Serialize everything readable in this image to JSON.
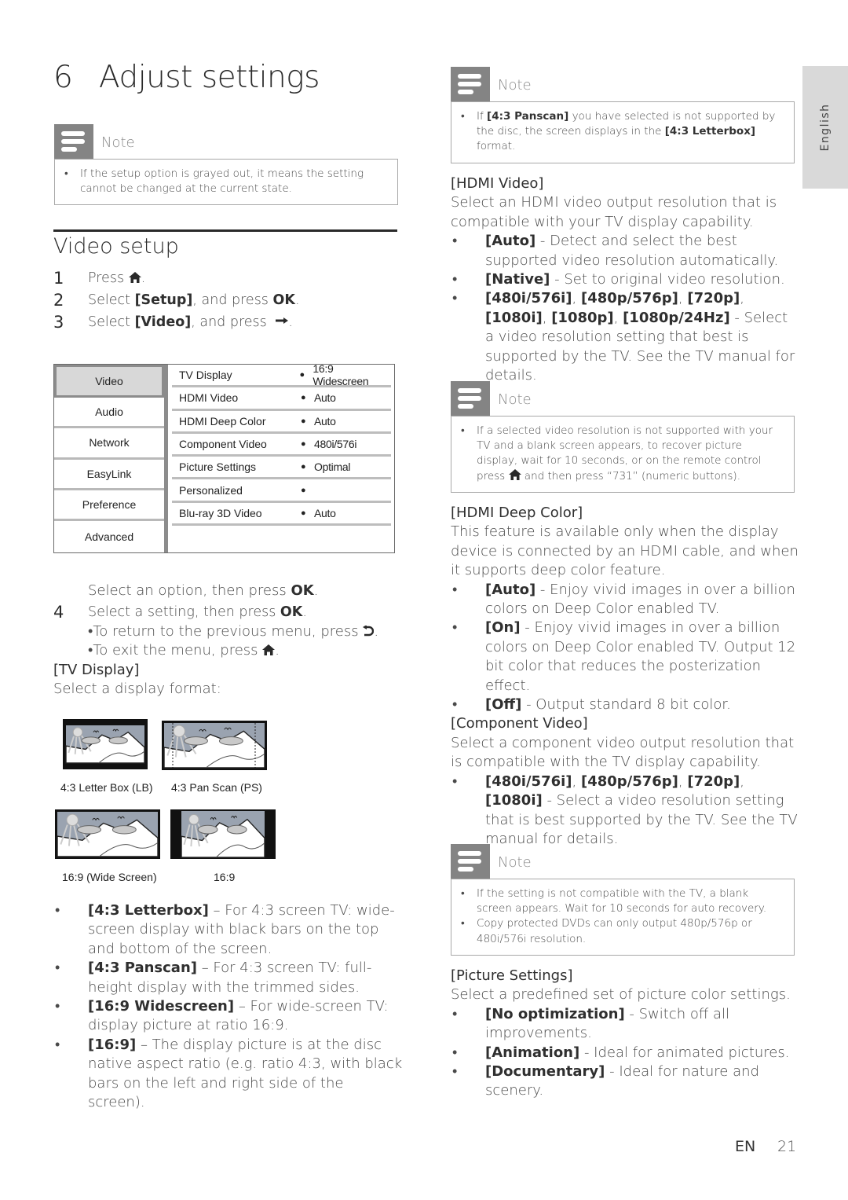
{
  "chapter": {
    "number": "6",
    "title": "Adjust settings"
  },
  "language_tab": "English",
  "notes": [
    {
      "label": "Note",
      "items": [
        {
          "parts": [
            {
              "t": "If the setup option is grayed out, it means the setting cannot be changed at the current state."
            }
          ]
        }
      ]
    },
    {
      "label": "Note",
      "items": [
        {
          "parts": [
            {
              "t": "If "
            },
            {
              "b": "[4:3 Panscan]"
            },
            {
              "t": " you have selected is not supported by the disc, the screen displays in the "
            },
            {
              "b": "[4:3 Letterbox]"
            },
            {
              "t": " format."
            }
          ]
        }
      ]
    },
    {
      "label": "Note",
      "items": [
        {
          "parts": [
            {
              "t": "If a selected video resolution is not supported with your TV and a blank screen appears, to recover picture display, wait for 10 seconds, or on the remote control press "
            },
            {
              "icon": "home"
            },
            {
              "t": " and then press “731” (numeric buttons)."
            }
          ]
        }
      ]
    },
    {
      "label": "Note",
      "items": [
        {
          "parts": [
            {
              "t": "If the setting is not compatible with the TV, a blank screen appears. Wait for 10 seconds for auto recovery."
            }
          ]
        },
        {
          "parts": [
            {
              "t": "Copy protected DVDs can only output 480p/576p or 480i/576i resolution."
            }
          ]
        }
      ]
    }
  ],
  "section": {
    "title": "Video setup",
    "steps": [
      {
        "n": "1",
        "parts": [
          {
            "t": "Press "
          },
          {
            "icon": "home"
          },
          {
            "t": "."
          }
        ]
      },
      {
        "n": "2",
        "parts": [
          {
            "t": "Select "
          },
          {
            "b": "[Setup]"
          },
          {
            "t": ", and press "
          },
          {
            "b": "OK"
          },
          {
            "t": "."
          }
        ]
      },
      {
        "n": "3",
        "parts": [
          {
            "t": "Select "
          },
          {
            "b": "[Video]"
          },
          {
            "t": ", and press "
          },
          {
            "icon": "right"
          },
          {
            "t": "."
          }
        ]
      }
    ],
    "after_menu": {
      "parts": [
        {
          "t": "Select an option, then press "
        },
        {
          "b": "OK"
        },
        {
          "t": "."
        }
      ]
    },
    "step4": {
      "n": "4",
      "parts": [
        {
          "t": "Select a setting, then press "
        },
        {
          "b": "OK"
        },
        {
          "t": "."
        }
      ]
    },
    "step4_sub": [
      {
        "parts": [
          {
            "t": "To return to the previous menu, press "
          },
          {
            "icon": "back"
          },
          {
            "t": "."
          }
        ]
      },
      {
        "parts": [
          {
            "t": "To exit the menu, press "
          },
          {
            "icon": "home"
          },
          {
            "t": "."
          }
        ]
      }
    ]
  },
  "menu": {
    "categories": [
      "Video",
      "Audio",
      "Network",
      "EasyLink",
      "Preference",
      "Advanced"
    ],
    "selected_category": "Video",
    "options": [
      {
        "name": "TV Display",
        "value": "16:9 Widescreen"
      },
      {
        "name": "HDMI Video",
        "value": "Auto"
      },
      {
        "name": "HDMI Deep Color",
        "value": "Auto"
      },
      {
        "name": "Component Video",
        "value": "480i/576i"
      },
      {
        "name": "Picture Settings",
        "value": "Optimal"
      },
      {
        "name": "Personalized",
        "value": ""
      },
      {
        "name": "Blu-ray 3D Video",
        "value": "Auto"
      }
    ]
  },
  "tv_display": {
    "heading": "[TV Display]",
    "intro": "Select a display format:",
    "formats": [
      {
        "caption": "4:3 Letter Box (LB)",
        "kind": "letterbox"
      },
      {
        "caption": "4:3 Pan Scan (PS)",
        "kind": "panscan"
      },
      {
        "caption": "16:9 (Wide Screen)",
        "kind": "wide"
      },
      {
        "caption": "16:9",
        "kind": "pillar"
      }
    ],
    "bullets": [
      {
        "parts": [
          {
            "b": "[4:3 Letterbox]"
          },
          {
            "t": " – For 4:3 screen TV: wide-screen display with black bars on the top and bottom of the screen."
          }
        ]
      },
      {
        "parts": [
          {
            "b": "[4:3 Panscan]"
          },
          {
            "t": " – For 4:3 screen TV: full-height display with the trimmed sides."
          }
        ]
      },
      {
        "parts": [
          {
            "b": "[16:9 Widescreen]"
          },
          {
            "t": " – For wide-screen TV: display picture at ratio 16:9."
          }
        ]
      },
      {
        "parts": [
          {
            "b": "[16:9]"
          },
          {
            "t": " – The display picture is at the disc native aspect ratio (e.g. ratio 4:3, with black bars on the left and right side of the screen)."
          }
        ]
      }
    ]
  },
  "hdmi_video": {
    "heading": "[HDMI Video]",
    "intro": "Select an HDMI video output resolution that is compatible with your TV display capability.",
    "bullets": [
      {
        "parts": [
          {
            "b": "[Auto]"
          },
          {
            "t": " - Detect and select the best supported video resolution automatically."
          }
        ]
      },
      {
        "parts": [
          {
            "b": "[Native]"
          },
          {
            "t": " - Set to original video resolution."
          }
        ]
      },
      {
        "parts": [
          {
            "b": "[480i/576i]"
          },
          {
            "t": ", "
          },
          {
            "b": "[480p/576p]"
          },
          {
            "t": ", "
          },
          {
            "b": "[720p]"
          },
          {
            "t": ", "
          },
          {
            "b": "[1080i]"
          },
          {
            "t": ", "
          },
          {
            "b": "[1080p]"
          },
          {
            "t": ", "
          },
          {
            "b": "[1080p/24Hz]"
          },
          {
            "t": " - Select a video resolution setting that best is supported by the TV. See the TV manual for details."
          }
        ]
      }
    ]
  },
  "hdmi_deep_color": {
    "heading": "[HDMI Deep Color]",
    "intro": "This feature is available only when the display device is connected by an HDMI cable, and when it supports deep color feature.",
    "bullets": [
      {
        "parts": [
          {
            "b": "[Auto]"
          },
          {
            "t": " - Enjoy vivid images in over a billion colors on Deep Color enabled TV."
          }
        ]
      },
      {
        "parts": [
          {
            "b": "[On]"
          },
          {
            "t": " - Enjoy vivid images in over a billion colors on Deep Color enabled TV. Output 12 bit color that reduces the posterization effect."
          }
        ]
      },
      {
        "parts": [
          {
            "b": "[Off]"
          },
          {
            "t": " - Output standard 8 bit color."
          }
        ]
      }
    ]
  },
  "component_video": {
    "heading": "[Component Video]",
    "intro": "Select a component video output resolution that is compatible with the TV display capability.",
    "bullets": [
      {
        "parts": [
          {
            "b": "[480i/576i]"
          },
          {
            "t": ", "
          },
          {
            "b": "[480p/576p]"
          },
          {
            "t": ", "
          },
          {
            "b": "[720p]"
          },
          {
            "t": ", "
          },
          {
            "b": "[1080i]"
          },
          {
            "t": " - Select a video resolution setting that is best supported by the TV. See the TV manual for details."
          }
        ]
      }
    ]
  },
  "picture_settings": {
    "heading": "[Picture Settings]",
    "intro": "Select a predefined set of picture color settings.",
    "bullets": [
      {
        "parts": [
          {
            "b": "[No optimization]"
          },
          {
            "t": " - Switch off all improvements."
          }
        ]
      },
      {
        "parts": [
          {
            "b": "[Animation]"
          },
          {
            "t": " - Ideal for animated pictures."
          }
        ]
      },
      {
        "parts": [
          {
            "b": "[Documentary]"
          },
          {
            "t": " - Ideal for nature and scenery."
          }
        ]
      }
    ]
  },
  "footer": {
    "lang": "EN",
    "page": "21"
  }
}
